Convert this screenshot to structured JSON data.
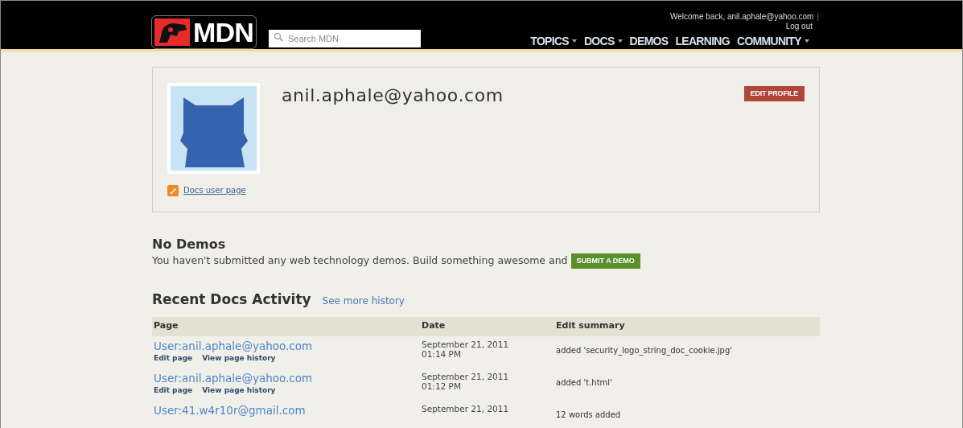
{
  "header": {
    "logo": "MDN",
    "search": {
      "placeholder": "Search MDN"
    },
    "welcome": "Welcome back, anil.aphale@yahoo.com",
    "separator": "|",
    "logout": "Log out",
    "nav": [
      {
        "label": "TOPICS",
        "dropdown": true
      },
      {
        "label": "DOCS",
        "dropdown": true
      },
      {
        "label": "DEMOS",
        "dropdown": false
      },
      {
        "label": "LEARNING",
        "dropdown": false
      },
      {
        "label": "COMMUNITY",
        "dropdown": true
      }
    ]
  },
  "profile": {
    "name": "anil.aphale@yahoo.com",
    "edit_button": "EDIT PROFILE",
    "docs_link": "Docs user page"
  },
  "demos": {
    "heading": "No Demos",
    "text": "You haven't submitted any web technology demos. Build something awesome and",
    "button": "SUBMIT A DEMO"
  },
  "activity": {
    "heading": "Recent Docs Activity",
    "more_link": "See more history",
    "table": {
      "columns": [
        "Page",
        "Date",
        "Edit summary"
      ],
      "rows": [
        {
          "page": "User:anil.aphale@yahoo.com",
          "actions": [
            "Edit page",
            "View page history"
          ],
          "date": [
            "September 21, 2011",
            "01:14 PM"
          ],
          "summary": "added 'security_logo_string_doc_cookie.jpg'"
        },
        {
          "page": "User:anil.aphale@yahoo.com",
          "actions": [
            "Edit page",
            "View page history"
          ],
          "date": [
            "September 21, 2011",
            "01:12 PM"
          ],
          "summary": "added 't.html'"
        },
        {
          "page": "User:41.w4r10r@gmail.com",
          "date": [
            "September 21, 2011"
          ],
          "summary": "12 words added"
        }
      ]
    }
  }
}
